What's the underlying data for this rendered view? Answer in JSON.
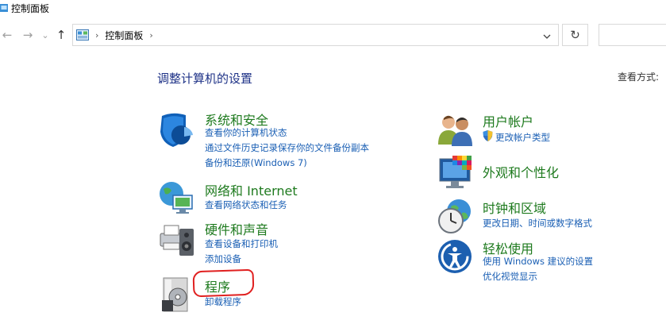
{
  "window": {
    "title": "控制面板"
  },
  "nav": {
    "back": "←",
    "forward": "→",
    "recent": "⌄",
    "up": "↑",
    "breadcrumb": "控制面板",
    "separator": "›",
    "dropdown": "⌄",
    "refresh": "↻"
  },
  "heading": "调整计算机的设置",
  "view_by": "查看方式:",
  "categories": [
    {
      "title": "系统和安全",
      "icon": "shield-icon",
      "links": [
        "查看你的计算机状态",
        "通过文件历史记录保存你的文件备份副本",
        "备份和还原(Windows 7)"
      ]
    },
    {
      "title": "网络和 Internet",
      "icon": "network-globe-icon",
      "links": [
        "查看网络状态和任务"
      ]
    },
    {
      "title": "硬件和声音",
      "icon": "printer-speaker-icon",
      "links": [
        "查看设备和打印机",
        "添加设备"
      ]
    },
    {
      "title": "程序",
      "icon": "programs-disc-icon",
      "links": [
        "卸载程序"
      ]
    },
    {
      "title": "用户帐户",
      "icon": "users-icon",
      "links": [
        "更改帐户类型"
      ]
    },
    {
      "title": "外观和个性化",
      "icon": "monitor-palette-icon",
      "links": []
    },
    {
      "title": "时钟和区域",
      "icon": "clock-globe-icon",
      "links": [
        "更改日期、时间或数字格式"
      ]
    },
    {
      "title": "轻松使用",
      "icon": "ease-of-access-icon",
      "links": [
        "使用 Windows 建议的设置",
        "优化视觉显示"
      ]
    }
  ],
  "colors": {
    "category_title": "#1e7a1e",
    "link": "#1a5fb4",
    "heading": "#1e3287",
    "highlight_circle": "#e02020"
  }
}
